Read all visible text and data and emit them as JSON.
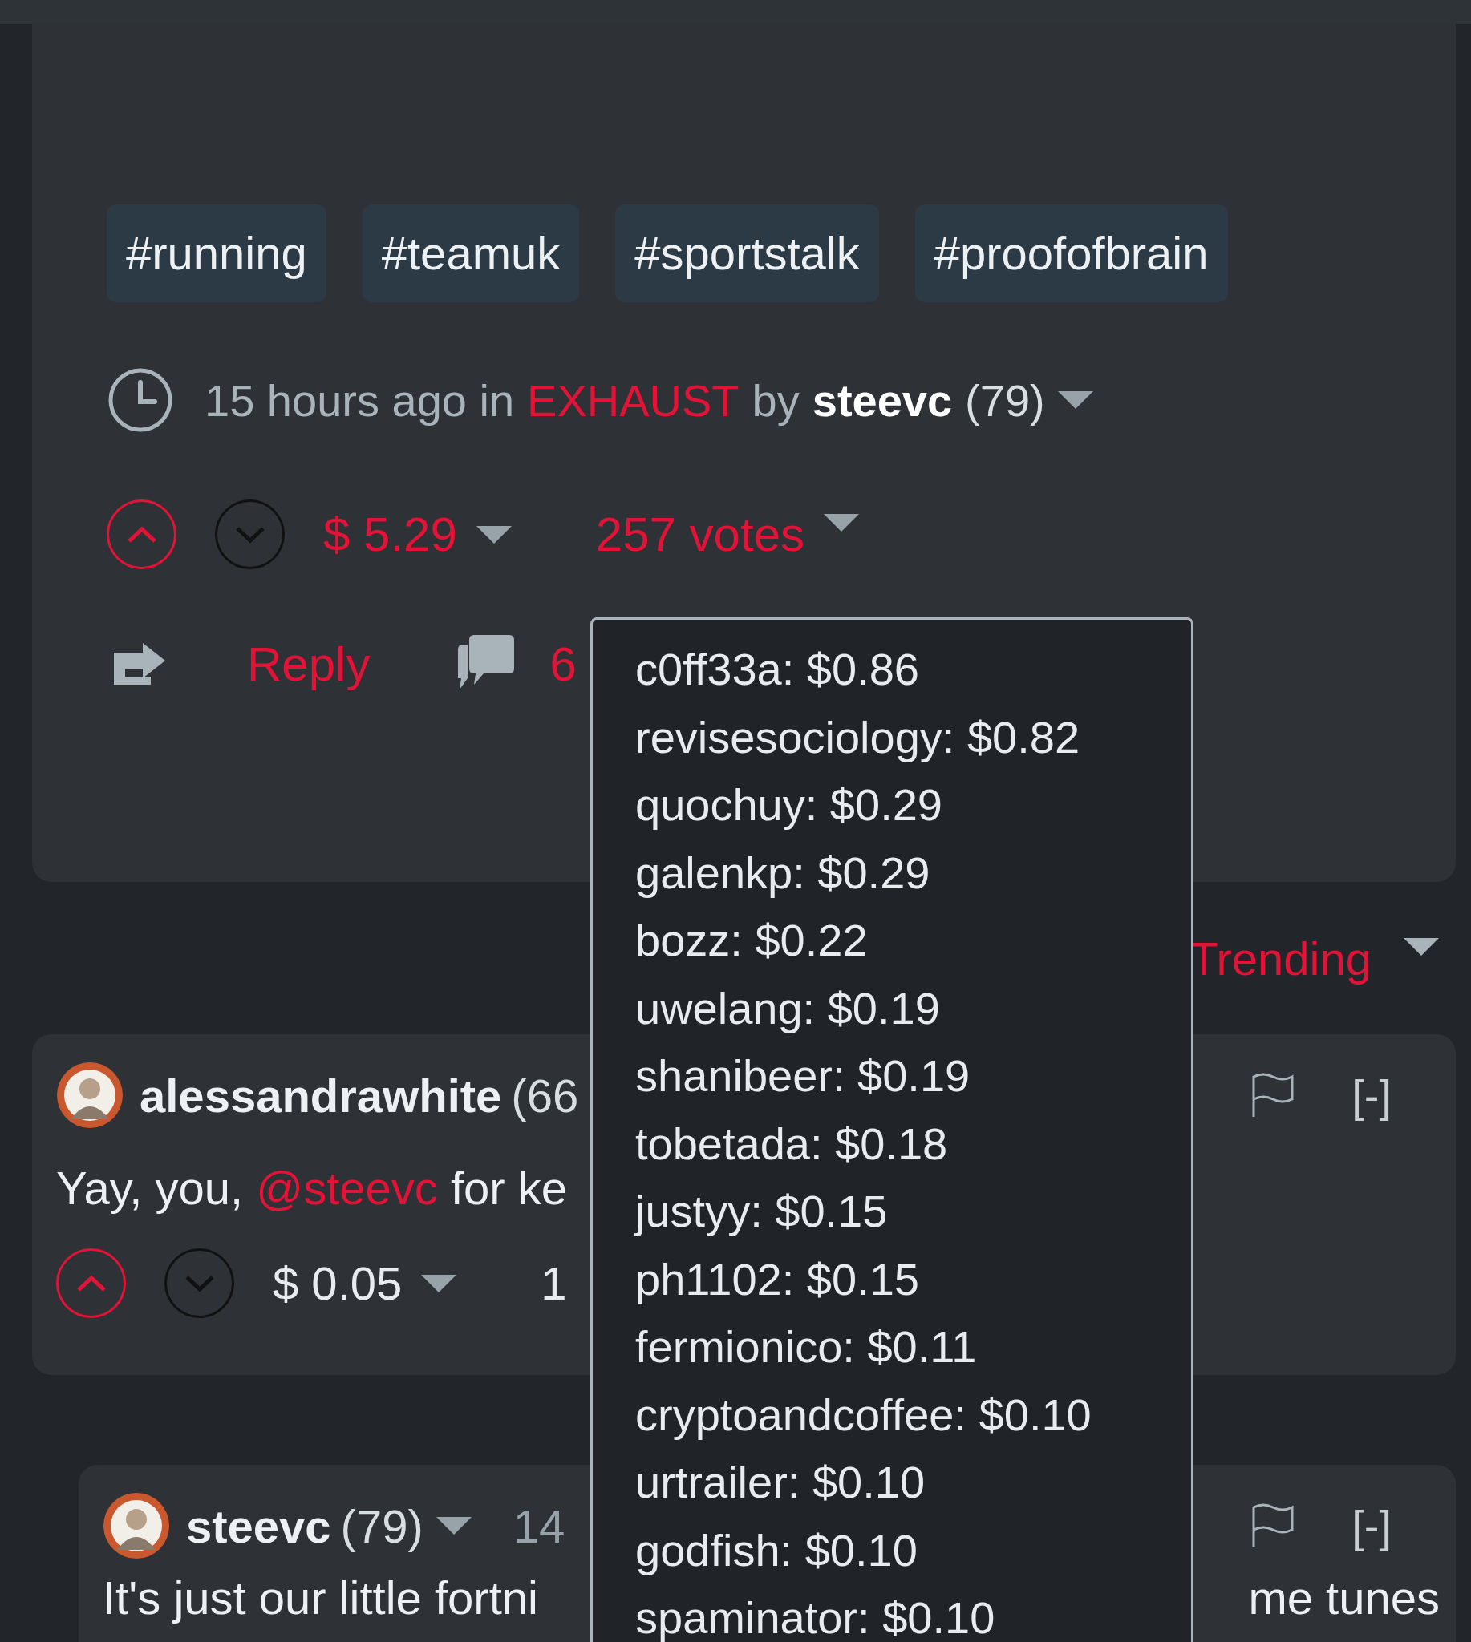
{
  "post": {
    "tags": [
      "#running",
      "#teamuk",
      "#sportstalk",
      "#proofofbrain"
    ],
    "meta": {
      "time": "15 hours ago in",
      "community": "EXHAUST",
      "by": "by",
      "author": "steevc",
      "reputation": "(79)"
    },
    "upvoted": true,
    "payout": "$ 5.29",
    "votes": "257 votes",
    "reply": "Reply",
    "comments": "6"
  },
  "sort": {
    "label": "Trending"
  },
  "comments": [
    {
      "author": "alessandrawhite",
      "reputation": "(66",
      "author_caret": false,
      "nested": false,
      "body": [
        {
          "text": "Yay, you, "
        },
        {
          "text": "@steevc",
          "kind": "mention"
        },
        {
          "text": " for ke"
        }
      ],
      "upvoted": true,
      "payout": "$ 0.05",
      "votes": "1",
      "collapse": "[-]"
    },
    {
      "author": "steevc",
      "reputation": "(79)",
      "author_caret": true,
      "time": "14",
      "nested": true,
      "body": [
        {
          "text": "It's just our little fortni"
        }
      ],
      "body_tail": "me tunes",
      "collapse": "[-]"
    }
  ],
  "votes_popup": {
    "items": [
      "c0ff33a: $0.86",
      "revisesociology: $0.82",
      "quochuy: $0.29",
      "galenkp: $0.29",
      "bozz: $0.22",
      "uwelang: $0.19",
      "shanibeer: $0.19",
      "tobetada: $0.18",
      "justyy: $0.15",
      "ph1102: $0.15",
      "fermionico: $0.11",
      "cryptoandcoffee: $0.10",
      "urtrailer: $0.10",
      "godfish: $0.10",
      "spaminator: $0.10"
    ]
  }
}
